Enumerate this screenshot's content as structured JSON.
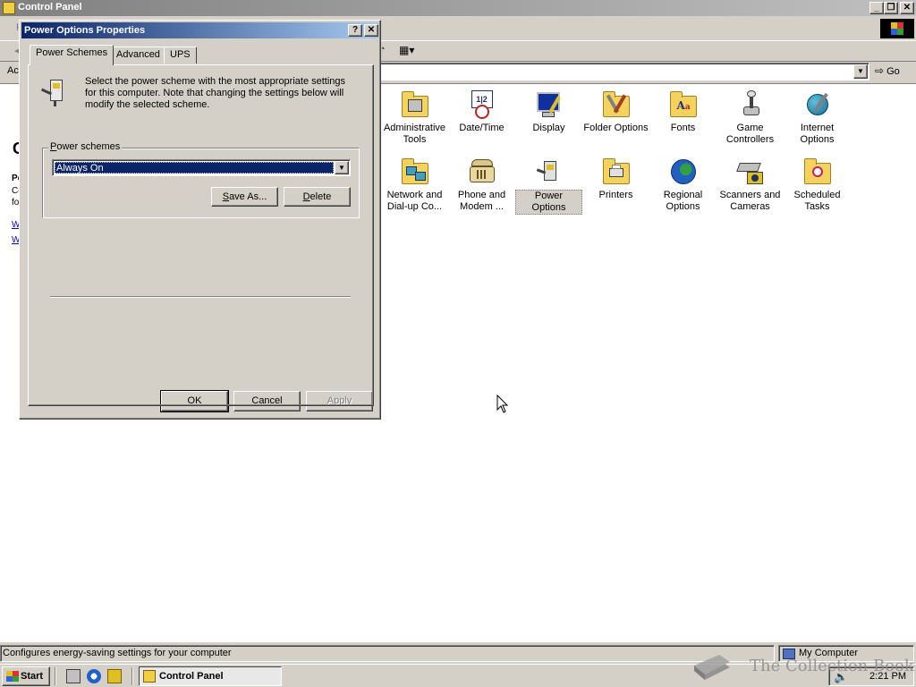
{
  "main_window": {
    "title": "Control Panel",
    "menubar_first_letter": "F",
    "address_label": "Ac",
    "go_label": "Go",
    "left_pane": {
      "heading_letter": "C",
      "p1": "Po",
      "p2": "Co",
      "p3": "fo",
      "link1": "W",
      "link2": "W"
    },
    "items": [
      {
        "label": "Administrative Tools",
        "icon": "administrative-tools-icon"
      },
      {
        "label": "Date/Time",
        "icon": "date-time-icon"
      },
      {
        "label": "Display",
        "icon": "display-icon"
      },
      {
        "label": "Folder Options",
        "icon": "folder-options-icon"
      },
      {
        "label": "Fonts",
        "icon": "fonts-icon"
      },
      {
        "label": "Game Controllers",
        "icon": "game-controllers-icon"
      },
      {
        "label": "Internet Options",
        "icon": "internet-options-icon"
      },
      {
        "label": "Network and Dial-up Co...",
        "icon": "network-icon"
      },
      {
        "label": "Phone and Modem ...",
        "icon": "phone-modem-icon"
      },
      {
        "label": "Power Options",
        "icon": "power-options-icon",
        "selected": true
      },
      {
        "label": "Printers",
        "icon": "printers-icon"
      },
      {
        "label": "Regional Options",
        "icon": "regional-options-icon"
      },
      {
        "label": "Scanners and Cameras",
        "icon": "scanners-cameras-icon"
      },
      {
        "label": "Scheduled Tasks",
        "icon": "scheduled-tasks-icon"
      }
    ],
    "status_text": "Configures energy-saving settings for your computer",
    "status_zone": "My Computer"
  },
  "dialog": {
    "title": "Power Options Properties",
    "help_label": "?",
    "close_label": "✕",
    "tabs": [
      {
        "label": "Power Schemes",
        "active": true
      },
      {
        "label": "Advanced"
      },
      {
        "label": "UPS"
      }
    ],
    "intro": "Select the power scheme with the most appropriate settings for this computer. Note that changing the settings below will modify the selected scheme.",
    "group_label": "Power schemes",
    "scheme_value": "Always On",
    "save_as_label": "Save As...",
    "delete_label": "Delete",
    "ok_label": "OK",
    "cancel_label": "Cancel",
    "apply_label": "Apply"
  },
  "taskbar": {
    "start_label": "Start",
    "task_label": "Control Panel",
    "clock": "2:21 PM"
  },
  "watermark": "The Collection Book"
}
